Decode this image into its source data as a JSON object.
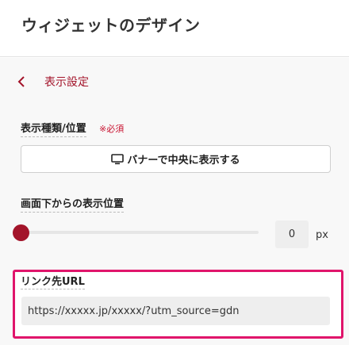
{
  "header": {
    "title": "ウィジェットのデザイン"
  },
  "nav": {
    "back_label": "表示設定"
  },
  "display_type": {
    "label": "表示種類/位置",
    "required": "※必須",
    "button_label": "バナーで中央に表示する",
    "button_icon": "monitor-icon"
  },
  "position": {
    "label": "画面下からの表示位置",
    "value": "0",
    "unit": "px",
    "slider_fraction": 0
  },
  "link": {
    "label": "リンク先URL",
    "url": "https://xxxxx.jp/xxxxx/?utm_source=gdn"
  },
  "colors": {
    "accent": "#a3142a",
    "highlight": "#e0156b"
  }
}
